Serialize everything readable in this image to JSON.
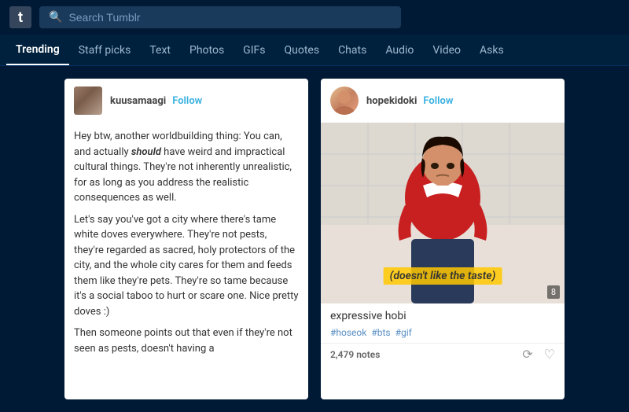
{
  "topbar": {
    "logo": "t",
    "search_placeholder": "Search Tumblr"
  },
  "nav": {
    "items": [
      {
        "label": "Trending",
        "active": true
      },
      {
        "label": "Staff picks",
        "active": false
      },
      {
        "label": "Text",
        "active": false
      },
      {
        "label": "Photos",
        "active": false
      },
      {
        "label": "GIFs",
        "active": false
      },
      {
        "label": "Quotes",
        "active": false
      },
      {
        "label": "Chats",
        "active": false
      },
      {
        "label": "Audio",
        "active": false
      },
      {
        "label": "Video",
        "active": false
      },
      {
        "label": "Asks",
        "active": false
      }
    ]
  },
  "posts": [
    {
      "author": "kuusamaagi",
      "follow_label": "Follow",
      "paragraphs": [
        "Hey btw, another worldbuilding thing: You can, and actually should have weird and impractical cultural things. They're not inherently unrealistic, for as long as you address the realistic consequences as well.",
        "Let's say you've got a city where there's tame white doves everywhere. They're not pests, they're regarded as sacred, holy protectors of the city, and the whole city cares for them and feeds them like they're pets. They're so tame because it's a social taboo to hurt or scare one. Nice pretty doves :)",
        "Then someone points out that even if they're not seen as pests, doesn't having a"
      ]
    },
    {
      "author": "hopekidoki",
      "follow_label": "Follow",
      "image_caption": "(doesn't like the taste)",
      "image_badge": "8",
      "post_title": "expressive hobi",
      "tags": [
        "#hoseok",
        "#bts",
        "#gif"
      ],
      "notes": "2,479 notes"
    }
  ],
  "icons": {
    "search": "🔍",
    "reblog": "🔁",
    "heart": "♥",
    "follow_color": "#35afe0"
  }
}
